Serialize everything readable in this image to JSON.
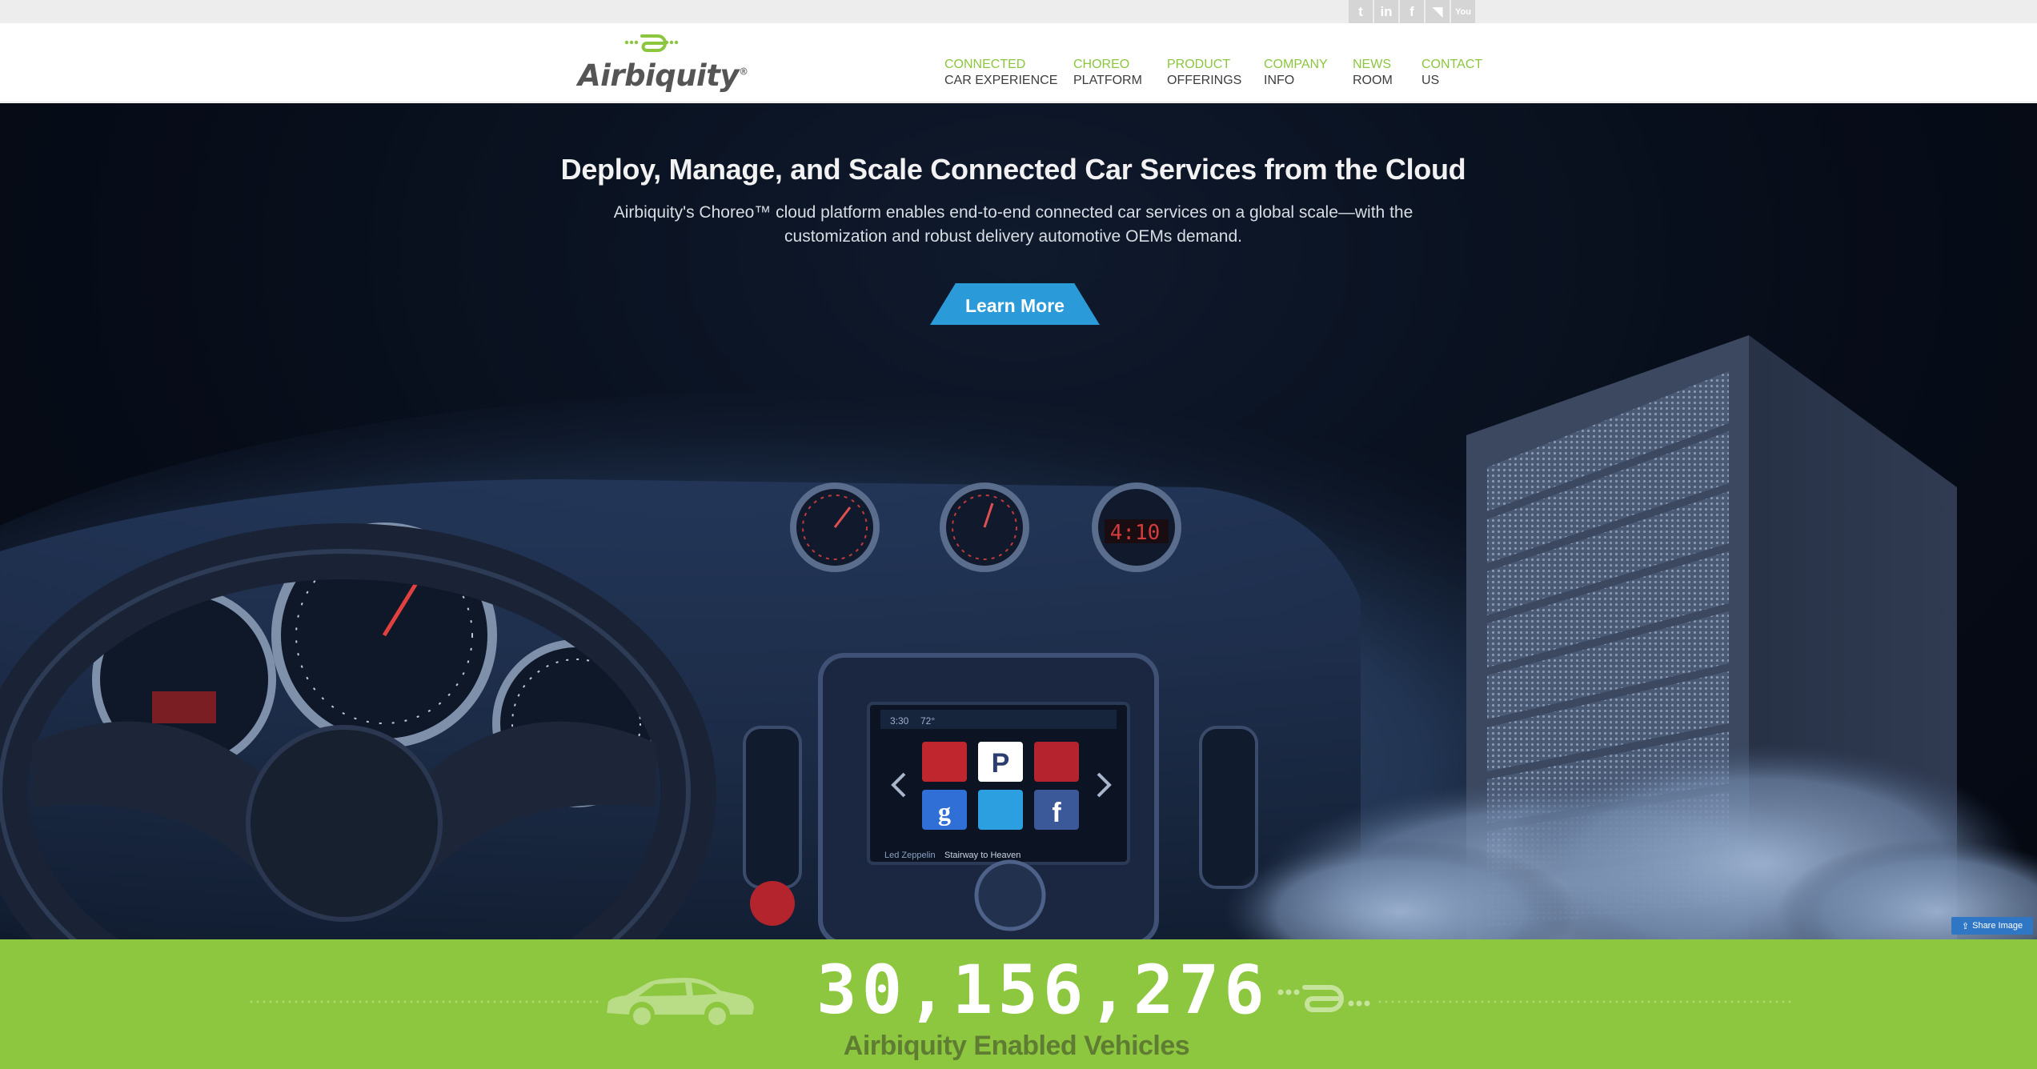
{
  "social": {
    "icons": [
      "twitter-icon",
      "linkedin-icon",
      "facebook-icon",
      "rss-icon",
      "youtube-icon"
    ],
    "glyphs": [
      "t",
      "in",
      "f",
      "◥",
      "You"
    ]
  },
  "header": {
    "logo_text": "Airbiquity",
    "nav": [
      {
        "line1": "CONNECTED",
        "line2": "CAR EXPERIENCE"
      },
      {
        "line1": "CHOREO",
        "line2": "PLATFORM"
      },
      {
        "line1": "PRODUCT",
        "line2": "OFFERINGS"
      },
      {
        "line1": "COMPANY",
        "line2": "INFO"
      },
      {
        "line1": "NEWS",
        "line2": "ROOM"
      },
      {
        "line1": "CONTACT",
        "line2": "US"
      }
    ]
  },
  "hero": {
    "title": "Deploy, Manage, and Scale Connected Car Services from the Cloud",
    "subtitle": "Airbiquity's Choreo™ cloud platform enables end-to-end connected car services on a global scale—with the customization and robust delivery automotive OEMs demand.",
    "cta_label": "Learn More",
    "share_label": "Share Image",
    "screen_status": "3:30",
    "screen_temp": "72°",
    "now_playing": "Led Zeppelin",
    "now_playing_track": "Stairway to Heaven",
    "clock": "4:10"
  },
  "stats": {
    "count": "30,156,276",
    "label": "Airbiquity Enabled Vehicles"
  },
  "colors": {
    "brand_green": "#8dc63f",
    "nav_green": "#8cc63f",
    "cta_blue": "#2a9ad9",
    "hero_bg": "#070d19"
  }
}
